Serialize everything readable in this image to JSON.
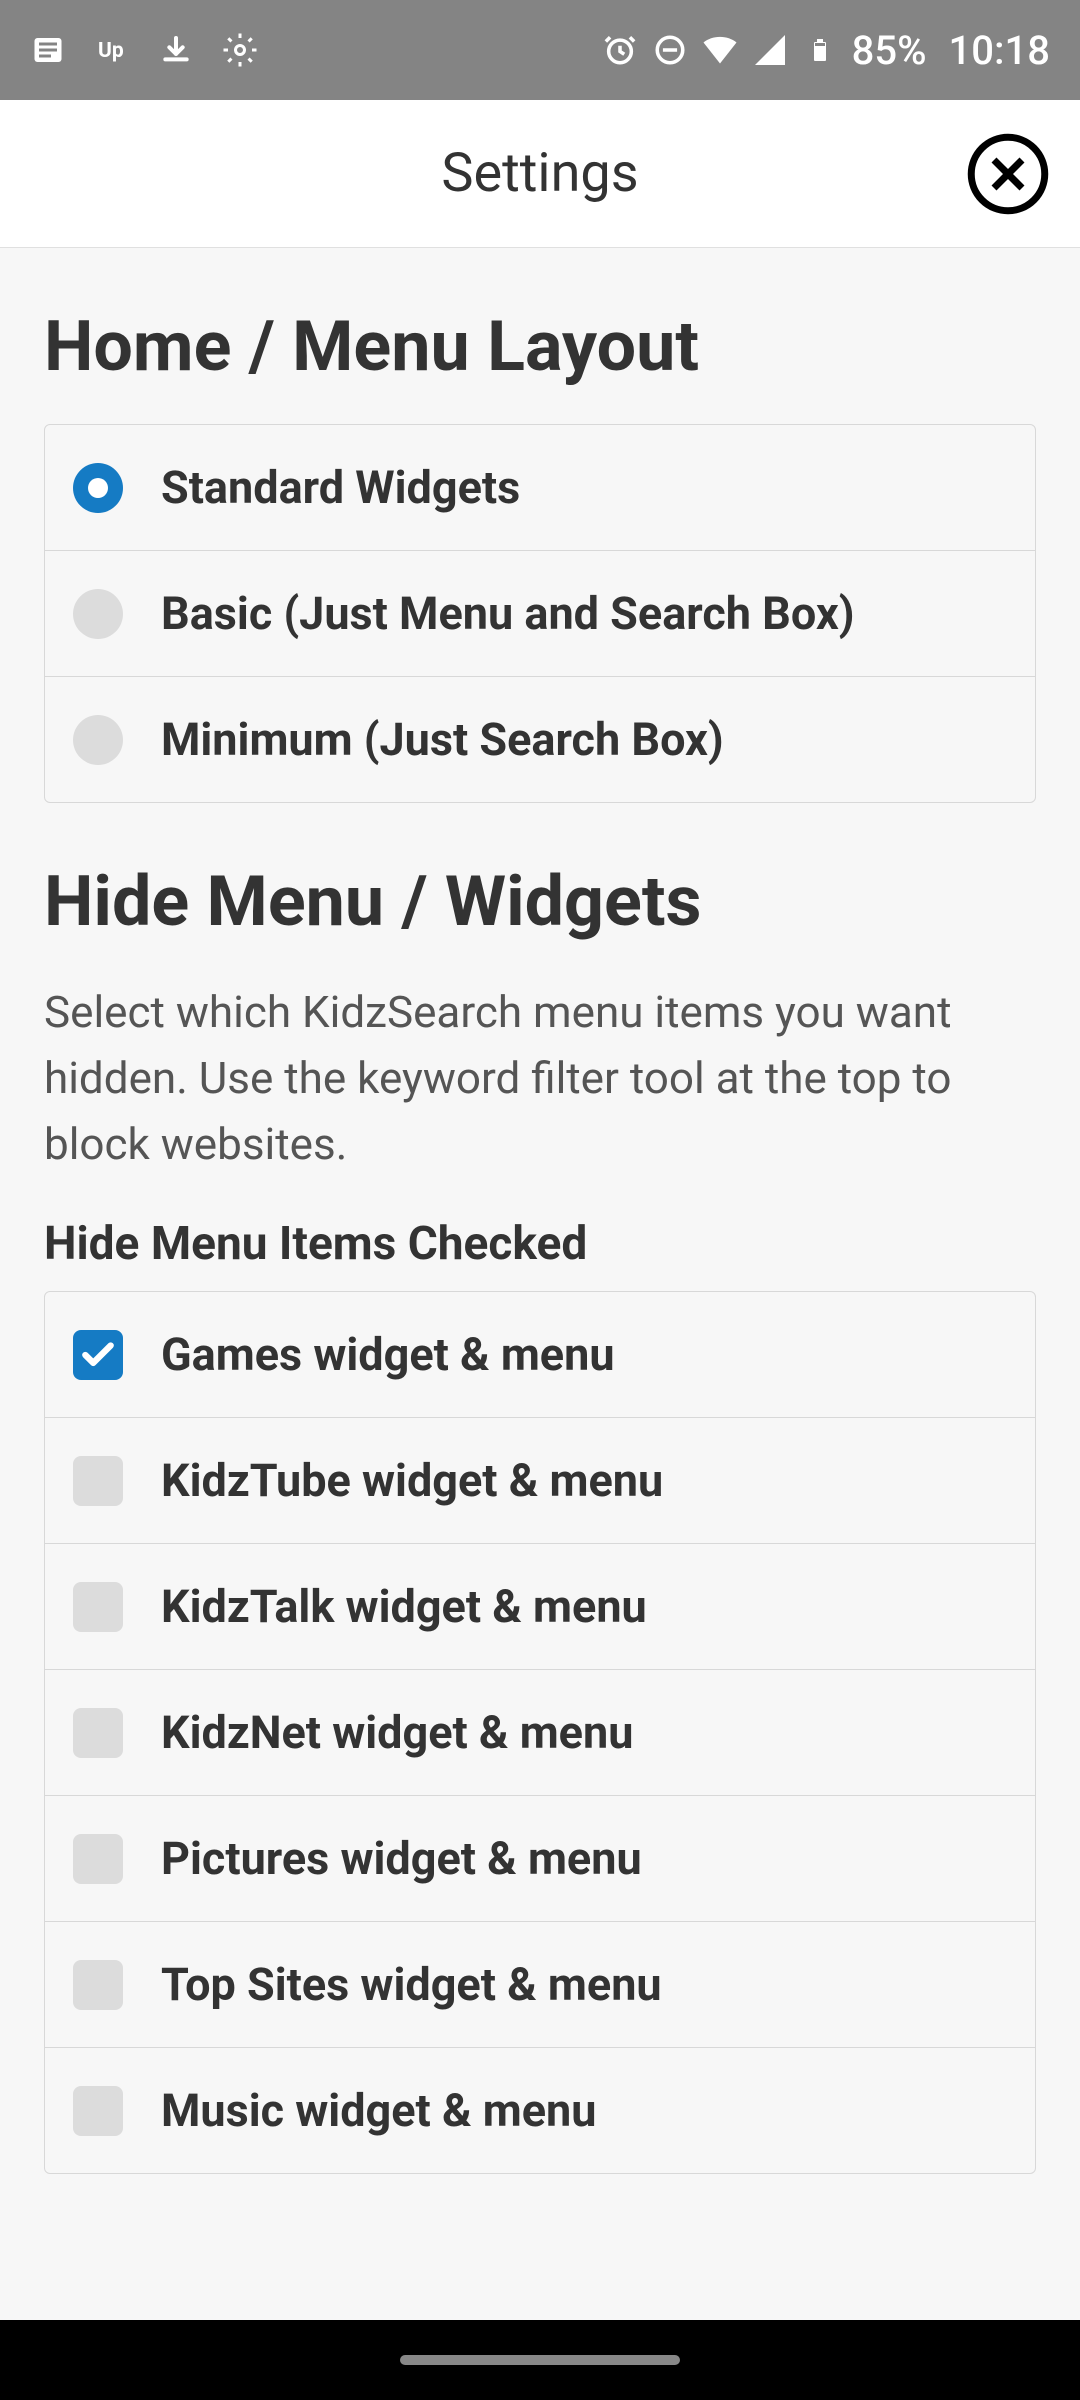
{
  "status": {
    "battery": "85%",
    "time": "10:18"
  },
  "header": {
    "title": "Settings"
  },
  "section1": {
    "title": "Home / Menu Layout",
    "options": [
      {
        "label": "Standard Widgets",
        "selected": true
      },
      {
        "label": "Basic (Just Menu and Search Box)",
        "selected": false
      },
      {
        "label": "Minimum (Just Search Box)",
        "selected": false
      }
    ]
  },
  "section2": {
    "title": "Hide Menu / Widgets",
    "description": "Select which KidzSearch menu items you want hidden. Use the keyword filter tool at the top to block websites.",
    "subtitle": "Hide Menu Items Checked",
    "options": [
      {
        "label": "Games widget & menu",
        "checked": true
      },
      {
        "label": "KidzTube widget & menu",
        "checked": false
      },
      {
        "label": "KidzTalk widget & menu",
        "checked": false
      },
      {
        "label": "KidzNet widget & menu",
        "checked": false
      },
      {
        "label": "Pictures widget & menu",
        "checked": false
      },
      {
        "label": "Top Sites widget & menu",
        "checked": false
      },
      {
        "label": "Music widget & menu",
        "checked": false
      }
    ]
  }
}
